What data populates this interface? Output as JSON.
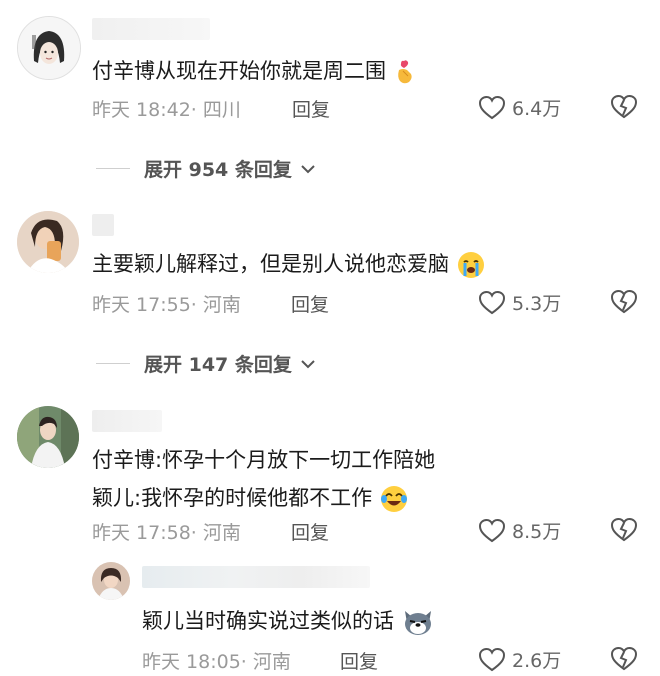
{
  "comments": [
    {
      "text": "付辛博从现在开始你就是周二围",
      "emoji": "heart-hand-emoji",
      "time": "昨天 18:42",
      "location": "· 四川",
      "reply_label": "回复",
      "likes": "6.4万",
      "expand_label": "展开 954 条回复"
    },
    {
      "text": "主要颖儿解释过，但是别人说他恋爱脑",
      "emoji": "crying-face-emoji",
      "time": "昨天 17:55",
      "location": "· 河南",
      "reply_label": "回复",
      "likes": "5.3万",
      "expand_label": "展开 147 条回复"
    },
    {
      "text_line1": "付辛博:怀孕十个月放下一切工作陪她",
      "text_line2": "颖儿:我怀孕的时候他都不工作",
      "emoji": "laughing-tears-emoji",
      "time": "昨天 17:58",
      "location": "· 河南",
      "reply_label": "回复",
      "likes": "8.5万"
    }
  ],
  "sub_reply": {
    "text": "颖儿当时确实说过类似的话",
    "emoji": "dog-face-emoji",
    "time": "昨天 18:05",
    "location": "· 河南",
    "reply_label": "回复",
    "likes": "2.6万"
  },
  "colors": {
    "meta": "#9a9a9a",
    "icon": "#555555",
    "blur": "#eeeeee"
  }
}
